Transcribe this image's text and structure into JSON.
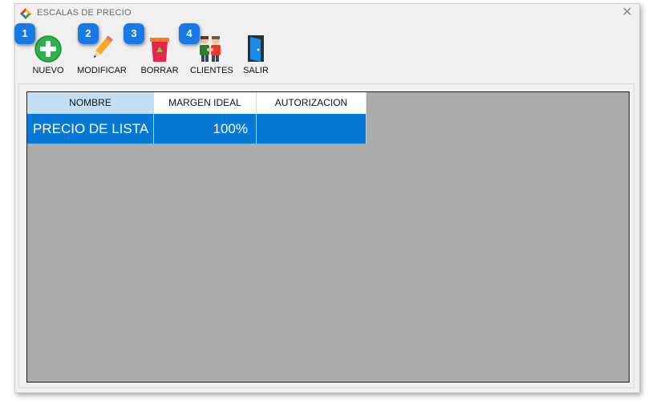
{
  "window": {
    "title": "ESCALAS DE PRECIO",
    "close_glyph": "✕"
  },
  "toolbar": {
    "items": [
      {
        "label": "NUEVO",
        "icon": "plus-circle-icon",
        "badge": "1"
      },
      {
        "label": "MODIFICAR",
        "icon": "pencil-icon",
        "badge": "2"
      },
      {
        "label": "BORRAR",
        "icon": "recycle-bin-icon",
        "badge": "3"
      },
      {
        "label": "CLIENTES",
        "icon": "clients-handshake-icon",
        "badge": "4"
      },
      {
        "label": "SALIR",
        "icon": "exit-door-icon"
      }
    ]
  },
  "table": {
    "columns": [
      "NOMBRE",
      "MARGEN IDEAL",
      "AUTORIZACION"
    ],
    "rows": [
      {
        "nombre": "PRECIO DE LISTA",
        "margen": "100%",
        "autorizacion": ""
      }
    ]
  },
  "colors": {
    "badge": "#1679e6",
    "selected_row": "#0878d7",
    "selected_header": "#c4dff3",
    "grid_background": "#ababab"
  }
}
